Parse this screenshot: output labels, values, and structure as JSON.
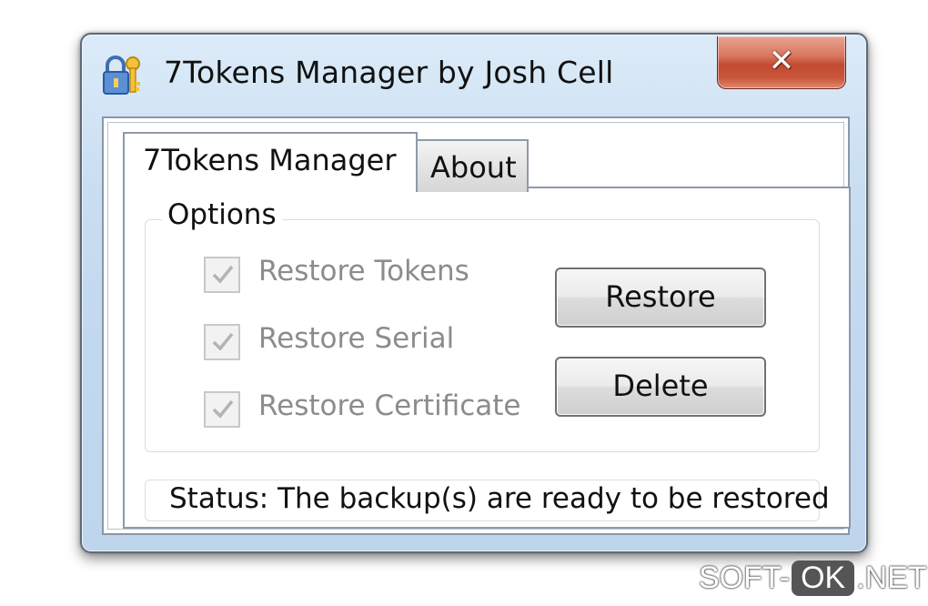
{
  "window": {
    "title": "7Tokens Manager by Josh Cell",
    "close_glyph": "✕",
    "icon": "lock-key-icon"
  },
  "tabs": [
    {
      "label": "7Tokens Manager",
      "active": true
    },
    {
      "label": "About",
      "active": false
    }
  ],
  "options": {
    "group_title": "Options",
    "checkboxes": [
      {
        "label": "Restore Tokens",
        "checked": true,
        "enabled": false
      },
      {
        "label": "Restore Serial",
        "checked": true,
        "enabled": false
      },
      {
        "label": "Restore Certificate",
        "checked": true,
        "enabled": false
      }
    ]
  },
  "buttons": {
    "restore": "Restore",
    "delete": "Delete"
  },
  "status": {
    "text": "Status:  The backup(s) are ready to be restored"
  },
  "watermark": {
    "prefix": "SOFT-",
    "middle": "OK",
    "suffix": ".NET"
  },
  "colors": {
    "frame": "#c2d8ef",
    "close_button": "#c24a31",
    "disabled_text": "#8c8c8c"
  }
}
